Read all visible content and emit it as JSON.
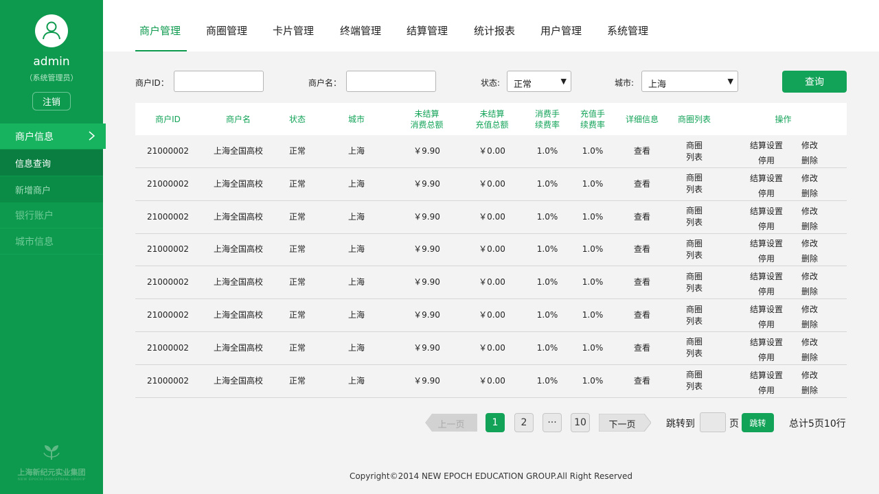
{
  "user": {
    "name": "admin",
    "role": "（系统管理员）",
    "logout_label": "注销"
  },
  "sidebar": {
    "section_label": "商户信息",
    "items": [
      {
        "label": "信息查询"
      },
      {
        "label": "新增商户"
      },
      {
        "label": "银行账户"
      },
      {
        "label": "城市信息"
      }
    ],
    "logo_text": "上海新纪元实业集团",
    "logo_sub": "NEW EPOCH INDUSTRIAL GROUP"
  },
  "topnav": {
    "tabs": [
      {
        "label": "商户管理"
      },
      {
        "label": "商圈管理"
      },
      {
        "label": "卡片管理"
      },
      {
        "label": "终端管理"
      },
      {
        "label": "结算管理"
      },
      {
        "label": "统计报表"
      },
      {
        "label": "用户管理"
      },
      {
        "label": "系统管理"
      }
    ]
  },
  "filters": {
    "merchant_id_label": "商户ID：",
    "merchant_name_label": "商户名：",
    "status_label": "状态:",
    "status_value": "正常",
    "city_label": "城市:",
    "city_value": "上海",
    "query_label": "查询"
  },
  "table": {
    "headers": [
      "商户ID",
      "商户名",
      "状态",
      "城市",
      "未结算\n消费总额",
      "未结算\n充值总额",
      "消费手\n续费率",
      "充值手\n续费率",
      "详细信息",
      "商圈列表",
      "操作"
    ],
    "rows": [
      {
        "id": "21000002",
        "name": "上海全国高校",
        "status": "正常",
        "city": "上海",
        "consume": "￥9.90",
        "recharge": "￥0.00",
        "consume_rate": "1.0%",
        "recharge_rate": "1.0%",
        "detail": "查看",
        "circle": "商圈\n列表"
      },
      {
        "id": "21000002",
        "name": "上海全国高校",
        "status": "正常",
        "city": "上海",
        "consume": "￥9.90",
        "recharge": "￥0.00",
        "consume_rate": "1.0%",
        "recharge_rate": "1.0%",
        "detail": "查看",
        "circle": "商圈\n列表"
      },
      {
        "id": "21000002",
        "name": "上海全国高校",
        "status": "正常",
        "city": "上海",
        "consume": "￥9.90",
        "recharge": "￥0.00",
        "consume_rate": "1.0%",
        "recharge_rate": "1.0%",
        "detail": "查看",
        "circle": "商圈\n列表"
      },
      {
        "id": "21000002",
        "name": "上海全国高校",
        "status": "正常",
        "city": "上海",
        "consume": "￥9.90",
        "recharge": "￥0.00",
        "consume_rate": "1.0%",
        "recharge_rate": "1.0%",
        "detail": "查看",
        "circle": "商圈\n列表"
      },
      {
        "id": "21000002",
        "name": "上海全国高校",
        "status": "正常",
        "city": "上海",
        "consume": "￥9.90",
        "recharge": "￥0.00",
        "consume_rate": "1.0%",
        "recharge_rate": "1.0%",
        "detail": "查看",
        "circle": "商圈\n列表"
      },
      {
        "id": "21000002",
        "name": "上海全国高校",
        "status": "正常",
        "city": "上海",
        "consume": "￥9.90",
        "recharge": "￥0.00",
        "consume_rate": "1.0%",
        "recharge_rate": "1.0%",
        "detail": "查看",
        "circle": "商圈\n列表"
      },
      {
        "id": "21000002",
        "name": "上海全国高校",
        "status": "正常",
        "city": "上海",
        "consume": "￥9.90",
        "recharge": "￥0.00",
        "consume_rate": "1.0%",
        "recharge_rate": "1.0%",
        "detail": "查看",
        "circle": "商圈\n列表"
      },
      {
        "id": "21000002",
        "name": "上海全国高校",
        "status": "正常",
        "city": "上海",
        "consume": "￥9.90",
        "recharge": "￥0.00",
        "consume_rate": "1.0%",
        "recharge_rate": "1.0%",
        "detail": "查看",
        "circle": "商圈\n列表"
      }
    ],
    "ops": {
      "settle": "结算设置",
      "edit": "修改",
      "disable": "停用",
      "delete": "删除"
    }
  },
  "pagination": {
    "prev_label": "上一页",
    "pages": [
      "1",
      "2",
      "···",
      "10"
    ],
    "current_page": "1",
    "next_label": "下一页",
    "jump_label": "跳转到",
    "page_unit": "页",
    "jump_button": "跳转",
    "total": "总计5页10行"
  },
  "footer": {
    "copyright": "Copyright©2014 NEW EPOCH EDUCATION GROUP.All Right Reserved"
  },
  "colors": {
    "primary": "#0e9a4e",
    "accent": "#13a358",
    "background": "#f4f3f4"
  }
}
